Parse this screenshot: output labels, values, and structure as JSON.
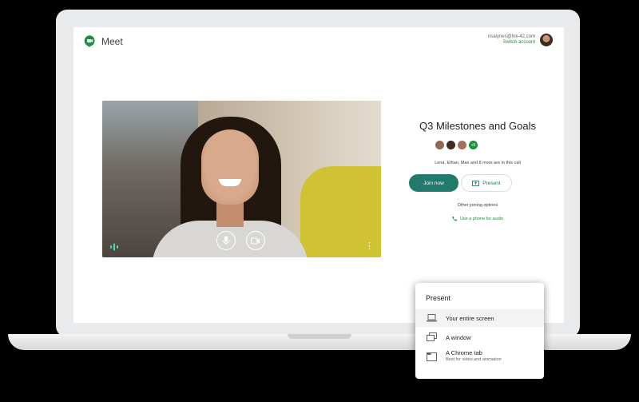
{
  "app": {
    "name": "Meet"
  },
  "account": {
    "email": "risalynes@lnk-42.com",
    "switch_label": "Switch account"
  },
  "meeting": {
    "title": "Q3 Milestones and Goals",
    "participants_more": "+5",
    "in_call_text": "Lena, Ethan, Max and 8 more are in this call",
    "join_label": "Join now",
    "present_label": "Present",
    "other_options_label": "Other joining options",
    "phone_label": "Use a phone for audio"
  },
  "present_menu": {
    "heading": "Present",
    "items": [
      {
        "label": "Your entire screen",
        "sub": ""
      },
      {
        "label": "A window",
        "sub": ""
      },
      {
        "label": "A Chrome tab",
        "sub": "Best for video and animation"
      }
    ]
  },
  "colors": {
    "accent": "#217a6c",
    "link": "#1e8e3e"
  }
}
